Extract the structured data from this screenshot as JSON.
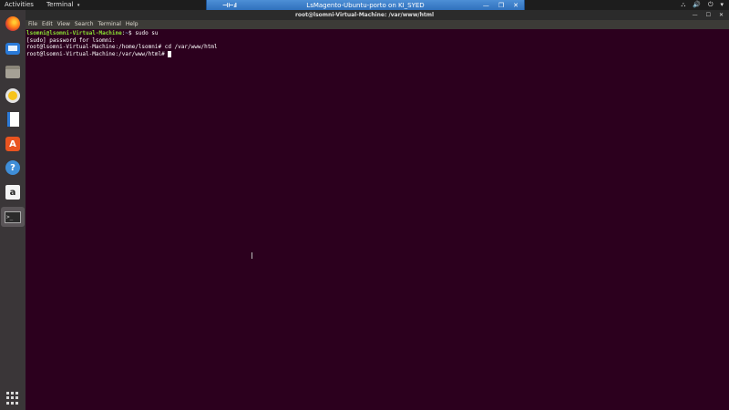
{
  "topbar": {
    "activities": "Activities",
    "app_menu": "Terminal",
    "app_menu_chevron": "▾",
    "tray": {
      "network_icon": "⛬",
      "volume_icon": "🔊",
      "power_icon": "⏻",
      "menu_chevron": "▾"
    }
  },
  "remote_bar": {
    "pin_icon": "⊣⊢",
    "signal_icon": ".ıll",
    "title": "LsMagento-Ubuntu-porto on KI_SYED",
    "minimize": "—",
    "restore": "❐",
    "close": "✕"
  },
  "window": {
    "title": "root@lsomni-Virtual-Machine: /var/www/html",
    "minimize": "—",
    "maximize": "☐",
    "close": "✕"
  },
  "menu": {
    "file": "File",
    "edit": "Edit",
    "view": "View",
    "search": "Search",
    "terminal": "Terminal",
    "help": "Help"
  },
  "dock": {
    "software_glyph": "A",
    "help_glyph": "?",
    "amazon_glyph": "a",
    "terminal_glyph": ">_"
  },
  "terminal": {
    "line1": {
      "user": "lsomni@lsomni-Virtual-Machine",
      "sep": ":",
      "path": "~",
      "cmd": "$ sudo su"
    },
    "line2": "[sudo] password for lsomni:",
    "line3": "root@lsomni-Virtual-Machine:/home/lsomni# cd /var/www/html",
    "line4": "root@lsomni-Virtual-Machine:/var/www/html# "
  },
  "colors": {
    "terminal_bg": "#2c001e",
    "prompt_user": "#8ae234",
    "prompt_path": "#729fcf",
    "remote_bar": "#3b7cc8"
  }
}
